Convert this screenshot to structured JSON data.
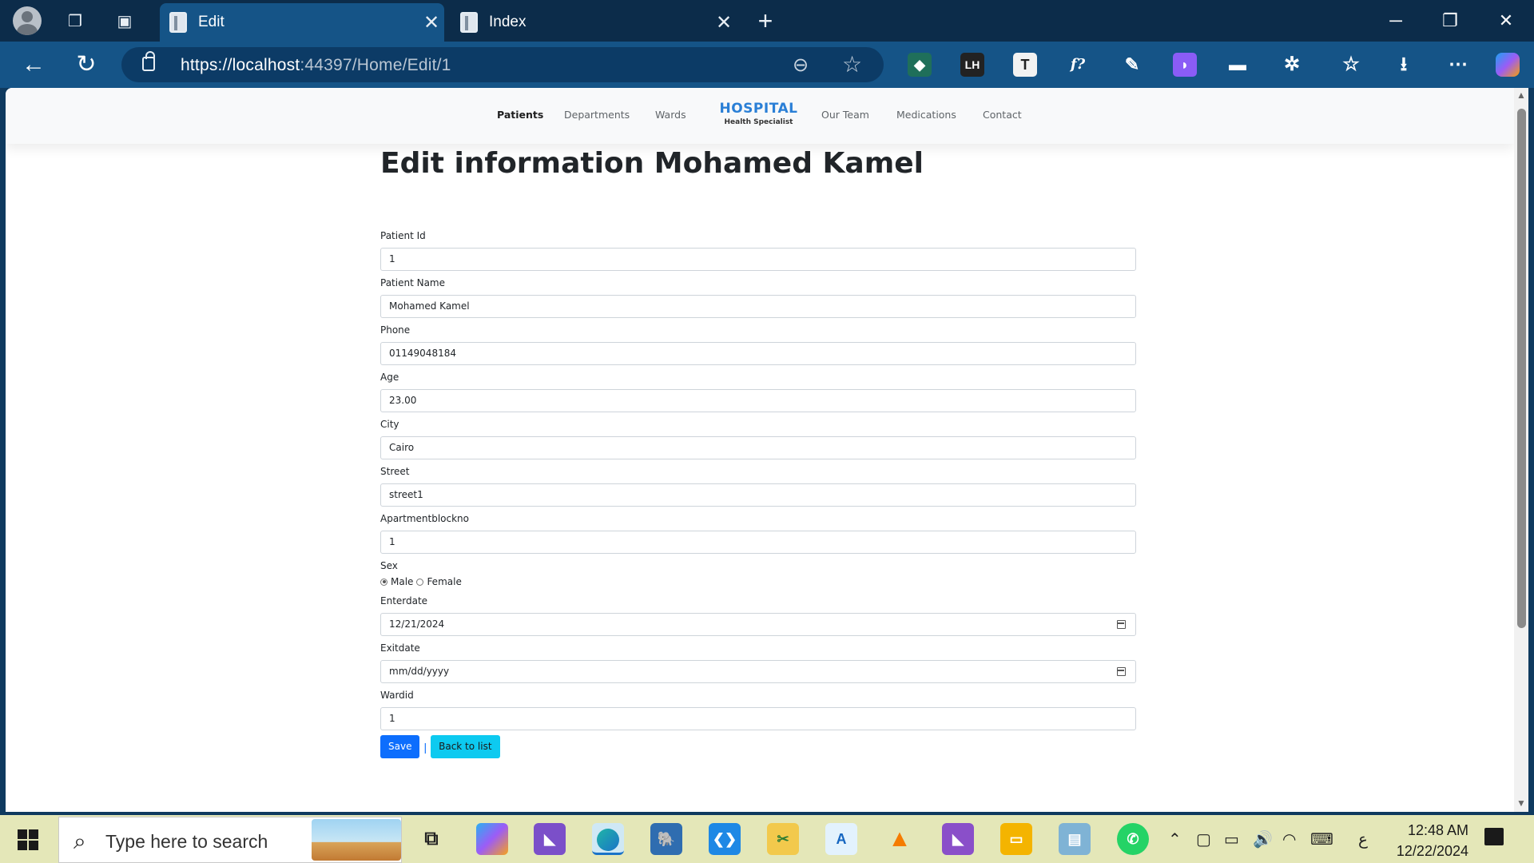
{
  "browser": {
    "tabs": [
      {
        "title": "Edit",
        "active": true
      },
      {
        "title": "Index",
        "active": false
      }
    ],
    "url_host": "https://localhost",
    "url_rest": ":44397/Home/Edit/1"
  },
  "extensions": [
    "LH",
    "T",
    "f?"
  ],
  "site": {
    "nav": {
      "patients": "Patients",
      "departments": "Departments",
      "wards": "Wards",
      "brand_name": "HOSPITAL",
      "brand_sub": "Health Specialist",
      "our_team": "Our Team",
      "medications": "Medications",
      "contact": "Contact"
    },
    "page_title": "Edit information Mohamed Kamel",
    "form": {
      "patient_id": {
        "label": "Patient Id",
        "value": "1"
      },
      "patient_name": {
        "label": "Patient Name",
        "value": "Mohamed Kamel"
      },
      "phone": {
        "label": "Phone",
        "value": "01149048184"
      },
      "age": {
        "label": "Age",
        "value": "23.00"
      },
      "city": {
        "label": "City",
        "value": "Cairo"
      },
      "street": {
        "label": "Street",
        "value": "street1"
      },
      "apartment": {
        "label": "Apartmentblockno",
        "value": "1"
      },
      "sex": {
        "label": "Sex",
        "male": "Male",
        "female": "Female",
        "selected": "Male"
      },
      "enterdate": {
        "label": "Enterdate",
        "value": "12/21/2024"
      },
      "exitdate": {
        "label": "Exitdate",
        "value": "mm/dd/yyyy"
      },
      "wardid": {
        "label": "Wardid",
        "value": "1"
      },
      "save": "Save",
      "separator": "|",
      "back": "Back to list"
    }
  },
  "taskbar": {
    "search_placeholder": "Type here to search",
    "time": "12:48 AM",
    "date": "12/22/2024",
    "lang": "ع"
  },
  "colors": {
    "brand": "#2a7fd6",
    "save_button": "#0d6efd",
    "back_button": "#0dcaf0",
    "taskbar": "#e4e7b8"
  }
}
